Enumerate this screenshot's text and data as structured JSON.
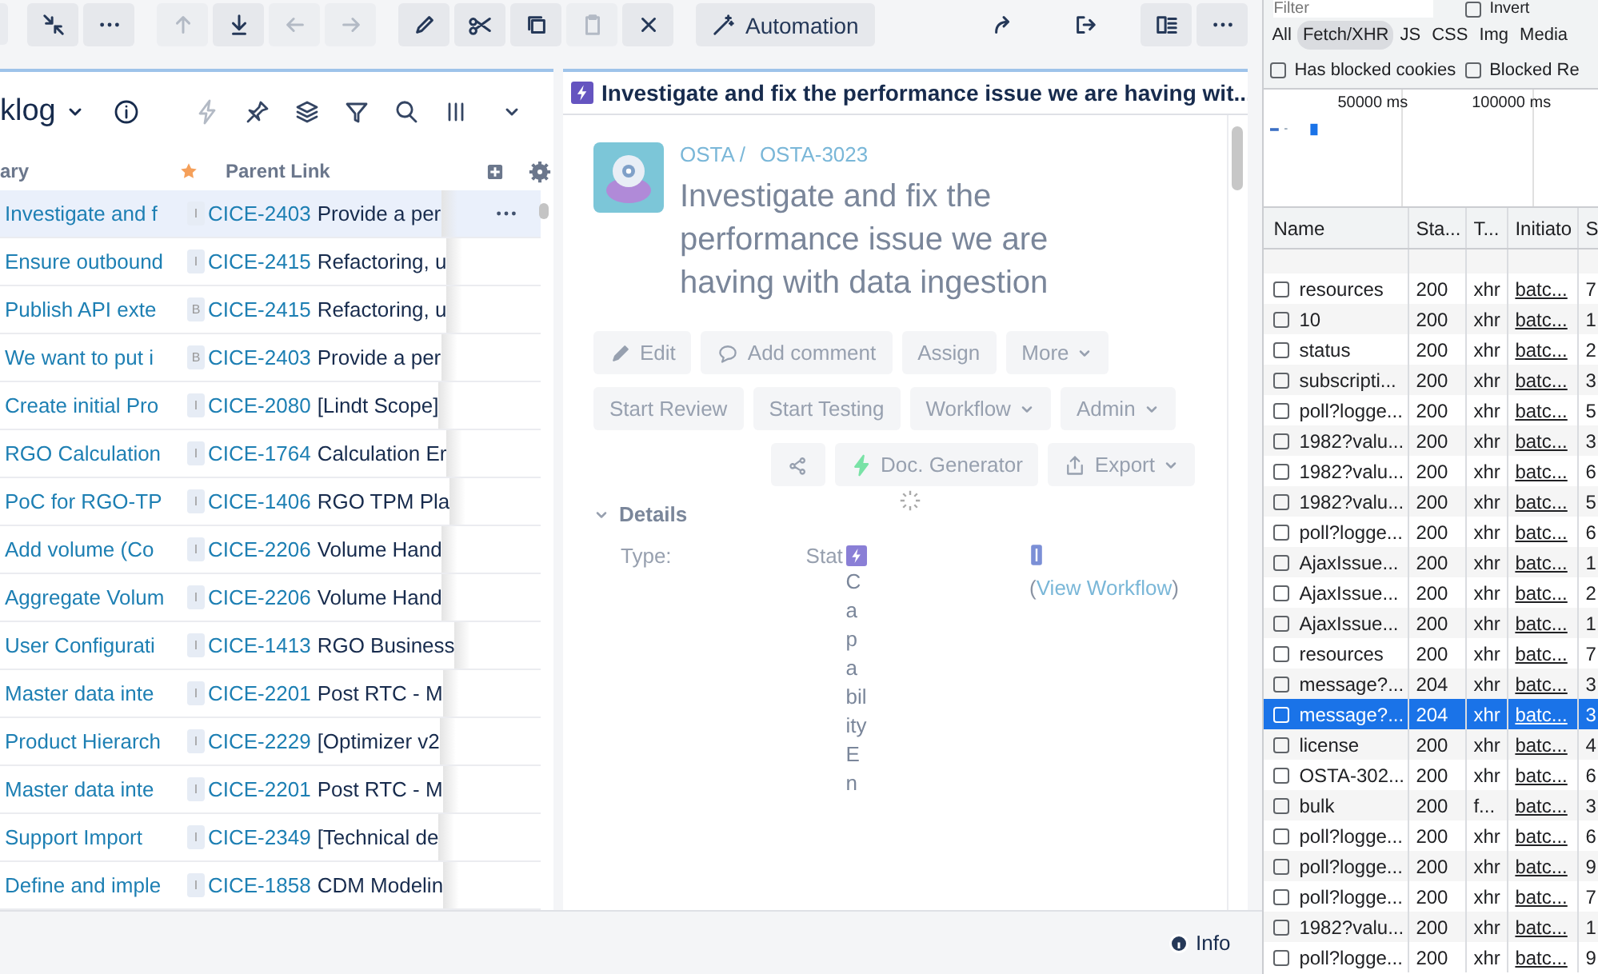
{
  "toolbar": {
    "groups": [
      {
        "buttons": [
          {
            "kind": "collapse",
            "disabled": false
          },
          {
            "kind": "more",
            "disabled": false
          }
        ]
      },
      {
        "buttons": [
          {
            "kind": "arrow-up",
            "disabled": true
          },
          {
            "kind": "arrow-down",
            "disabled": false
          },
          {
            "kind": "arrow-left",
            "disabled": true
          },
          {
            "kind": "arrow-right",
            "disabled": true
          }
        ]
      },
      {
        "buttons": [
          {
            "kind": "edit",
            "disabled": false
          },
          {
            "kind": "cut",
            "disabled": false
          },
          {
            "kind": "copy",
            "disabled": false
          },
          {
            "kind": "paste",
            "disabled": true
          },
          {
            "kind": "delete",
            "disabled": false
          }
        ]
      },
      {
        "buttons": [
          {
            "kind": "wand",
            "label": "Automation",
            "disabled": false
          }
        ]
      }
    ],
    "right_buttons": [
      {
        "kind": "forward",
        "disabled": false
      },
      {
        "kind": "exit",
        "disabled": false
      },
      {
        "kind": "layout",
        "disabled": false
      },
      {
        "kind": "more",
        "disabled": false
      }
    ]
  },
  "backlog": {
    "title": "klog",
    "tools": [
      {
        "kind": "lightning",
        "disabled": true
      },
      {
        "kind": "pin",
        "disabled": false
      },
      {
        "kind": "layers",
        "disabled": false
      },
      {
        "kind": "filter",
        "disabled": false
      },
      {
        "kind": "search",
        "disabled": false
      },
      {
        "kind": "columns",
        "disabled": false
      }
    ],
    "columns": [
      "ary",
      "Parent Link"
    ],
    "rows": [
      {
        "summary": "Investigate and f",
        "badge": "I",
        "key": "CICE-2403",
        "parent": "Provide a per",
        "selected": true
      },
      {
        "summary": "Ensure outbound",
        "badge": "I",
        "key": "CICE-2415",
        "parent": "Refactoring, u",
        "selected": false
      },
      {
        "summary": "Publish API exte",
        "badge": "B",
        "key": "CICE-2415",
        "parent": "Refactoring, u",
        "selected": false
      },
      {
        "summary": "We want to put i",
        "badge": "B",
        "key": "CICE-2403",
        "parent": "Provide a per",
        "selected": false
      },
      {
        "summary": "Create initial Pro",
        "badge": "I",
        "key": "CICE-2080",
        "parent": "[Lindt Scope]",
        "selected": false
      },
      {
        "summary": "RGO Calculation",
        "badge": "I",
        "key": "CICE-1764",
        "parent": "Calculation Er",
        "selected": false
      },
      {
        "summary": "PoC for RGO-TP",
        "badge": "I",
        "key": "CICE-1406",
        "parent": "RGO TPM Pla",
        "selected": false
      },
      {
        "summary": "Add volume (Co",
        "badge": "I",
        "key": "CICE-2206",
        "parent": "Volume Hand",
        "selected": false
      },
      {
        "summary": "Aggregate Volum",
        "badge": "I",
        "key": "CICE-2206",
        "parent": "Volume Hand",
        "selected": false
      },
      {
        "summary": "User Configurati",
        "badge": "I",
        "key": "CICE-1413",
        "parent": "RGO Business",
        "selected": false
      },
      {
        "summary": "Master data inte",
        "badge": "I",
        "key": "CICE-2201",
        "parent": "Post RTC - M",
        "selected": false
      },
      {
        "summary": "Product Hierarch",
        "badge": "I",
        "key": "CICE-2229",
        "parent": "[Optimizer v2",
        "selected": false
      },
      {
        "summary": "Master data inte",
        "badge": "I",
        "key": "CICE-2201",
        "parent": "Post RTC - M",
        "selected": false
      },
      {
        "summary": "Support Import",
        "badge": "I",
        "key": "CICE-2349",
        "parent": "[Technical de",
        "selected": false
      },
      {
        "summary": "Define and imple",
        "badge": "I",
        "key": "CICE-1858",
        "parent": "CDM Modelin",
        "selected": false
      }
    ]
  },
  "issue": {
    "header_title": "Investigate and fix the performance issue we are having wit...",
    "project": "OSTA /",
    "key": "OSTA-3023",
    "title": "Investigate and fix the performance issue we are having with data ingestion",
    "button_rows": [
      [
        {
          "label": "Edit",
          "kind": "edit"
        },
        {
          "label": "Add comment",
          "kind": "comment"
        },
        {
          "label": "Assign",
          "kind": "plain"
        },
        {
          "label": "More",
          "kind": "dropdown"
        }
      ],
      [
        {
          "label": "Start Review",
          "kind": "plain"
        },
        {
          "label": "Start Testing",
          "kind": "plain"
        },
        {
          "label": "Workflow",
          "kind": "dropdown"
        },
        {
          "label": "Admin",
          "kind": "dropdown"
        }
      ],
      [
        {
          "kind": "share"
        },
        {
          "label": "Doc. Generator",
          "kind": "lightning"
        },
        {
          "label": "Export",
          "kind": "export"
        }
      ]
    ],
    "details": {
      "heading": "Details",
      "expanded": true,
      "type_label": "Type:",
      "status_label": "Stat",
      "vertical_value": "CapabilityEn",
      "workflow_open": "(",
      "workflow_link": "View Workflow",
      "workflow_close": ")"
    }
  },
  "footer": {
    "info": "Info"
  },
  "devtools": {
    "filter_placeholder": "Filter",
    "invert": {
      "label": "Invert",
      "checked": false
    },
    "type_filters": [
      {
        "label": "All",
        "selected": false
      },
      {
        "label": "Fetch/XHR",
        "selected": true
      },
      {
        "label": "JS",
        "selected": false
      },
      {
        "label": "CSS",
        "selected": false
      },
      {
        "label": "Img",
        "selected": false
      },
      {
        "label": "Media",
        "selected": false
      }
    ],
    "checkboxes": [
      {
        "label": "Has blocked cookies",
        "checked": false
      },
      {
        "label": "Blocked Re",
        "checked": false
      }
    ],
    "timeline_labels": [
      "50000 ms",
      "100000 ms"
    ],
    "columns": [
      "Name",
      "Sta...",
      "T...",
      "Initiato",
      "S"
    ],
    "rows": [
      {
        "name": "resources",
        "status": "200",
        "type": "xhr",
        "initiator": "batc...",
        "size": "7",
        "checked": false,
        "selected": false
      },
      {
        "name": "10",
        "status": "200",
        "type": "xhr",
        "initiator": "batc...",
        "size": "1",
        "checked": false,
        "selected": false
      },
      {
        "name": "status",
        "status": "200",
        "type": "xhr",
        "initiator": "batc...",
        "size": "2",
        "checked": false,
        "selected": false
      },
      {
        "name": "subscripti...",
        "status": "200",
        "type": "xhr",
        "initiator": "batc...",
        "size": "3",
        "checked": false,
        "selected": false
      },
      {
        "name": "poll?logge...",
        "status": "200",
        "type": "xhr",
        "initiator": "batc...",
        "size": "5",
        "checked": false,
        "selected": false
      },
      {
        "name": "1982?valu...",
        "status": "200",
        "type": "xhr",
        "initiator": "batc...",
        "size": "3",
        "checked": false,
        "selected": false
      },
      {
        "name": "1982?valu...",
        "status": "200",
        "type": "xhr",
        "initiator": "batc...",
        "size": "6",
        "checked": false,
        "selected": false
      },
      {
        "name": "1982?valu...",
        "status": "200",
        "type": "xhr",
        "initiator": "batc...",
        "size": "5",
        "checked": false,
        "selected": false
      },
      {
        "name": "poll?logge...",
        "status": "200",
        "type": "xhr",
        "initiator": "batc...",
        "size": "6",
        "checked": false,
        "selected": false
      },
      {
        "name": "AjaxIssue...",
        "status": "200",
        "type": "xhr",
        "initiator": "batc...",
        "size": "1",
        "checked": false,
        "selected": false
      },
      {
        "name": "AjaxIssue...",
        "status": "200",
        "type": "xhr",
        "initiator": "batc...",
        "size": "2",
        "checked": false,
        "selected": false
      },
      {
        "name": "AjaxIssue...",
        "status": "200",
        "type": "xhr",
        "initiator": "batc...",
        "size": "1",
        "checked": false,
        "selected": false
      },
      {
        "name": "resources",
        "status": "200",
        "type": "xhr",
        "initiator": "batc...",
        "size": "7",
        "checked": false,
        "selected": false
      },
      {
        "name": "message?...",
        "status": "204",
        "type": "xhr",
        "initiator": "batc...",
        "size": "3",
        "checked": false,
        "selected": false
      },
      {
        "name": "message?...",
        "status": "204",
        "type": "xhr",
        "initiator": "batc...",
        "size": "3",
        "checked": false,
        "selected": true
      },
      {
        "name": "license",
        "status": "200",
        "type": "xhr",
        "initiator": "batc...",
        "size": "4",
        "checked": false,
        "selected": false
      },
      {
        "name": "OSTA-302...",
        "status": "200",
        "type": "xhr",
        "initiator": "batc...",
        "size": "6",
        "checked": false,
        "selected": false
      },
      {
        "name": "bulk",
        "status": "200",
        "type": "f...",
        "initiator": "batc...",
        "size": "3",
        "checked": false,
        "selected": false
      },
      {
        "name": "poll?logge...",
        "status": "200",
        "type": "xhr",
        "initiator": "batc...",
        "size": "6",
        "checked": false,
        "selected": false
      },
      {
        "name": "poll?logge...",
        "status": "200",
        "type": "xhr",
        "initiator": "batc...",
        "size": "9",
        "checked": false,
        "selected": false
      },
      {
        "name": "poll?logge...",
        "status": "200",
        "type": "xhr",
        "initiator": "batc...",
        "size": "7",
        "checked": false,
        "selected": false
      },
      {
        "name": "1982?valu...",
        "status": "200",
        "type": "xhr",
        "initiator": "batc...",
        "size": "1",
        "checked": false,
        "selected": false
      },
      {
        "name": "poll?logge...",
        "status": "200",
        "type": "xhr",
        "initiator": "batc...",
        "size": "9",
        "checked": false,
        "selected": false
      }
    ]
  }
}
